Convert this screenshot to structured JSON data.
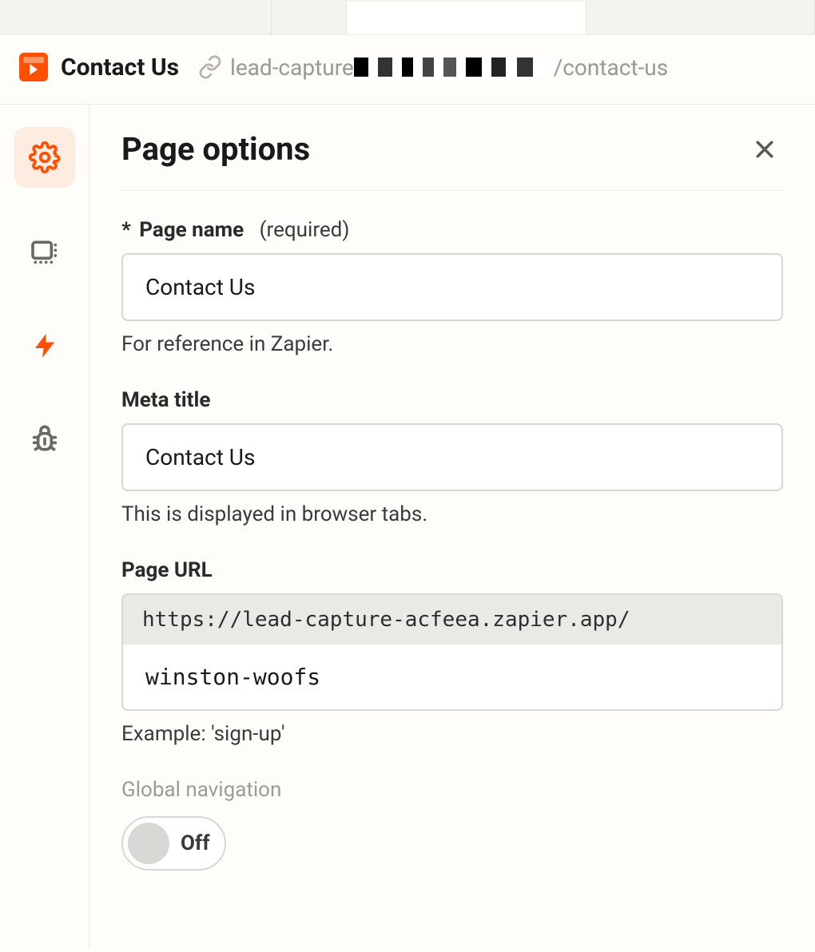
{
  "header": {
    "page_title": "Contact Us",
    "url_prefix": "lead-capture",
    "url_suffix": "/contact-us"
  },
  "sidebar": {
    "items": [
      {
        "name": "settings",
        "active": true
      },
      {
        "name": "layout",
        "active": false
      },
      {
        "name": "actions",
        "active": false
      },
      {
        "name": "debug",
        "active": false
      }
    ]
  },
  "panel": {
    "title": "Page options",
    "page_name": {
      "label": "Page name",
      "required_text": "(required)",
      "value": "Contact Us",
      "help": "For reference in Zapier."
    },
    "meta_title": {
      "label": "Meta title",
      "value": "Contact Us",
      "help": "This is displayed in browser tabs."
    },
    "page_url": {
      "label": "Page URL",
      "prefix": "https://lead-capture-acfeea.zapier.app/",
      "value": "winston-woofs",
      "help": "Example: 'sign-up'"
    },
    "global_nav": {
      "label": "Global navigation",
      "state_text": "Off",
      "on": false
    }
  }
}
